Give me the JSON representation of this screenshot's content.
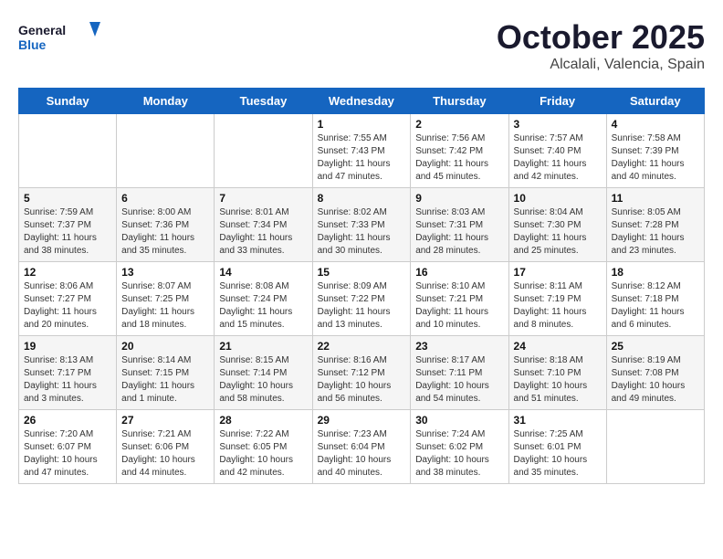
{
  "logo": {
    "line1": "General",
    "line2": "Blue"
  },
  "title": "October 2025",
  "subtitle": "Alcalali, Valencia, Spain",
  "weekdays": [
    "Sunday",
    "Monday",
    "Tuesday",
    "Wednesday",
    "Thursday",
    "Friday",
    "Saturday"
  ],
  "weeks": [
    [
      {
        "day": "",
        "info": ""
      },
      {
        "day": "",
        "info": ""
      },
      {
        "day": "",
        "info": ""
      },
      {
        "day": "1",
        "info": "Sunrise: 7:55 AM\nSunset: 7:43 PM\nDaylight: 11 hours\nand 47 minutes."
      },
      {
        "day": "2",
        "info": "Sunrise: 7:56 AM\nSunset: 7:42 PM\nDaylight: 11 hours\nand 45 minutes."
      },
      {
        "day": "3",
        "info": "Sunrise: 7:57 AM\nSunset: 7:40 PM\nDaylight: 11 hours\nand 42 minutes."
      },
      {
        "day": "4",
        "info": "Sunrise: 7:58 AM\nSunset: 7:39 PM\nDaylight: 11 hours\nand 40 minutes."
      }
    ],
    [
      {
        "day": "5",
        "info": "Sunrise: 7:59 AM\nSunset: 7:37 PM\nDaylight: 11 hours\nand 38 minutes."
      },
      {
        "day": "6",
        "info": "Sunrise: 8:00 AM\nSunset: 7:36 PM\nDaylight: 11 hours\nand 35 minutes."
      },
      {
        "day": "7",
        "info": "Sunrise: 8:01 AM\nSunset: 7:34 PM\nDaylight: 11 hours\nand 33 minutes."
      },
      {
        "day": "8",
        "info": "Sunrise: 8:02 AM\nSunset: 7:33 PM\nDaylight: 11 hours\nand 30 minutes."
      },
      {
        "day": "9",
        "info": "Sunrise: 8:03 AM\nSunset: 7:31 PM\nDaylight: 11 hours\nand 28 minutes."
      },
      {
        "day": "10",
        "info": "Sunrise: 8:04 AM\nSunset: 7:30 PM\nDaylight: 11 hours\nand 25 minutes."
      },
      {
        "day": "11",
        "info": "Sunrise: 8:05 AM\nSunset: 7:28 PM\nDaylight: 11 hours\nand 23 minutes."
      }
    ],
    [
      {
        "day": "12",
        "info": "Sunrise: 8:06 AM\nSunset: 7:27 PM\nDaylight: 11 hours\nand 20 minutes."
      },
      {
        "day": "13",
        "info": "Sunrise: 8:07 AM\nSunset: 7:25 PM\nDaylight: 11 hours\nand 18 minutes."
      },
      {
        "day": "14",
        "info": "Sunrise: 8:08 AM\nSunset: 7:24 PM\nDaylight: 11 hours\nand 15 minutes."
      },
      {
        "day": "15",
        "info": "Sunrise: 8:09 AM\nSunset: 7:22 PM\nDaylight: 11 hours\nand 13 minutes."
      },
      {
        "day": "16",
        "info": "Sunrise: 8:10 AM\nSunset: 7:21 PM\nDaylight: 11 hours\nand 10 minutes."
      },
      {
        "day": "17",
        "info": "Sunrise: 8:11 AM\nSunset: 7:19 PM\nDaylight: 11 hours\nand 8 minutes."
      },
      {
        "day": "18",
        "info": "Sunrise: 8:12 AM\nSunset: 7:18 PM\nDaylight: 11 hours\nand 6 minutes."
      }
    ],
    [
      {
        "day": "19",
        "info": "Sunrise: 8:13 AM\nSunset: 7:17 PM\nDaylight: 11 hours\nand 3 minutes."
      },
      {
        "day": "20",
        "info": "Sunrise: 8:14 AM\nSunset: 7:15 PM\nDaylight: 11 hours\nand 1 minute."
      },
      {
        "day": "21",
        "info": "Sunrise: 8:15 AM\nSunset: 7:14 PM\nDaylight: 10 hours\nand 58 minutes."
      },
      {
        "day": "22",
        "info": "Sunrise: 8:16 AM\nSunset: 7:12 PM\nDaylight: 10 hours\nand 56 minutes."
      },
      {
        "day": "23",
        "info": "Sunrise: 8:17 AM\nSunset: 7:11 PM\nDaylight: 10 hours\nand 54 minutes."
      },
      {
        "day": "24",
        "info": "Sunrise: 8:18 AM\nSunset: 7:10 PM\nDaylight: 10 hours\nand 51 minutes."
      },
      {
        "day": "25",
        "info": "Sunrise: 8:19 AM\nSunset: 7:08 PM\nDaylight: 10 hours\nand 49 minutes."
      }
    ],
    [
      {
        "day": "26",
        "info": "Sunrise: 7:20 AM\nSunset: 6:07 PM\nDaylight: 10 hours\nand 47 minutes."
      },
      {
        "day": "27",
        "info": "Sunrise: 7:21 AM\nSunset: 6:06 PM\nDaylight: 10 hours\nand 44 minutes."
      },
      {
        "day": "28",
        "info": "Sunrise: 7:22 AM\nSunset: 6:05 PM\nDaylight: 10 hours\nand 42 minutes."
      },
      {
        "day": "29",
        "info": "Sunrise: 7:23 AM\nSunset: 6:04 PM\nDaylight: 10 hours\nand 40 minutes."
      },
      {
        "day": "30",
        "info": "Sunrise: 7:24 AM\nSunset: 6:02 PM\nDaylight: 10 hours\nand 38 minutes."
      },
      {
        "day": "31",
        "info": "Sunrise: 7:25 AM\nSunset: 6:01 PM\nDaylight: 10 hours\nand 35 minutes."
      },
      {
        "day": "",
        "info": ""
      }
    ]
  ]
}
